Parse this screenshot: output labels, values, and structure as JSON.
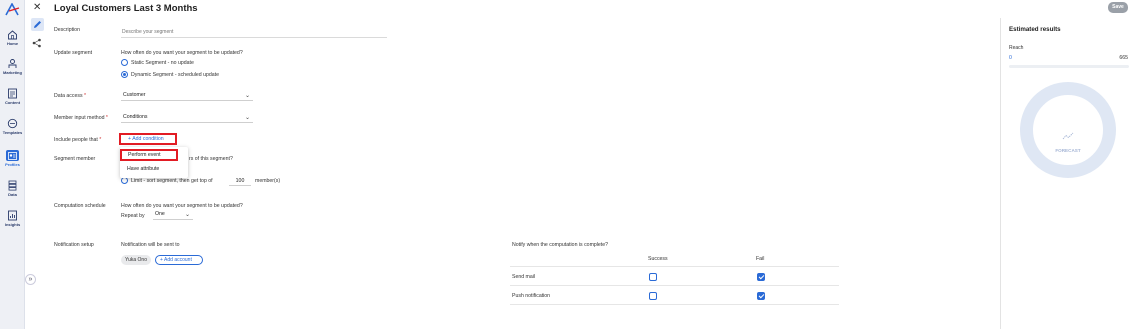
{
  "nav": {
    "items": [
      {
        "label": "Home",
        "icon": "home-icon"
      },
      {
        "label": "Marketing",
        "icon": "marketing-icon"
      },
      {
        "label": "Content",
        "icon": "content-icon"
      },
      {
        "label": "Templates",
        "icon": "templates-icon"
      },
      {
        "label": "Profiles",
        "icon": "profiles-icon"
      },
      {
        "label": "Data",
        "icon": "data-icon"
      },
      {
        "label": "Insights",
        "icon": "insights-icon"
      }
    ],
    "expand_glyph": "»"
  },
  "header": {
    "title": "Loyal Customers Last 3 Months",
    "save_label": "Save"
  },
  "form": {
    "description": {
      "label": "Description",
      "placeholder": "Describe your segment"
    },
    "update": {
      "label": "Update segment",
      "question": "How often do you want your segment to be updated?",
      "opt_static": "Static Segment - no update",
      "opt_dynamic": "Dynamic Segment - scheduled update"
    },
    "data_access": {
      "label": "Data access",
      "required": "*",
      "value": "Customer"
    },
    "member_input": {
      "label": "Member input method",
      "required": "*",
      "value": "Conditions"
    },
    "include": {
      "label": "Include people that",
      "required": "*",
      "add_condition": "Add condition"
    },
    "menu": {
      "perform_event": "Perform event",
      "have_attribute": "Have attribute"
    },
    "segment_member": {
      "label": "Segment member",
      "question_tail": "rs of this segment?",
      "limit_text": "Limit - sort segment, then get top of",
      "top_value": "100",
      "unit": "member(s)"
    },
    "computation": {
      "label": "Computation schedule",
      "question": "How often do you want your segment to be updated?",
      "repeat_label": "Repeat by",
      "repeat_value": "One"
    },
    "notification": {
      "label": "Notification setup",
      "sent_to": "Notification will be sent to",
      "chip": "Yuka Ono",
      "add_account": "Add account",
      "notify_question": "Notify when the computation is complete?",
      "col_success": "Success",
      "col_fail": "Fail",
      "rows": [
        {
          "label": "Send mail",
          "success": false,
          "fail": true
        },
        {
          "label": "Push notification",
          "success": false,
          "fail": true
        }
      ]
    }
  },
  "results": {
    "title": "Estimated results",
    "reach_label": "Reach",
    "reach_value": "0",
    "reach_max": "665",
    "forecast_label": "FORECAST"
  },
  "colors": {
    "accent": "#2a6ad6",
    "highlight": "#e21c24",
    "save_disabled": "#9aa0a8"
  }
}
